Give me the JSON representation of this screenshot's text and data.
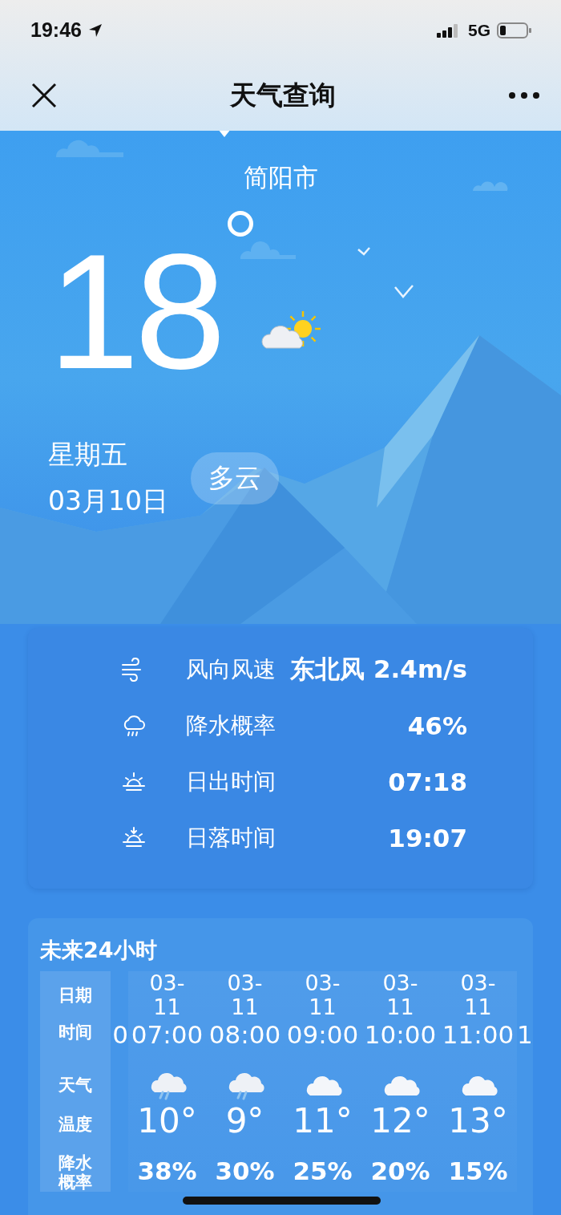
{
  "status_bar": {
    "time": "19:46",
    "network": "5G"
  },
  "nav": {
    "title": "天气查询"
  },
  "location": {
    "city": "简阳市"
  },
  "current": {
    "temperature": "18",
    "icon": {
      "kind": "partly_cloudy"
    },
    "weekday": "星期五",
    "date": "03月10日",
    "condition": "多云"
  },
  "details": [
    {
      "kind": "wind",
      "label": "风向风速",
      "value": "东北风 2.4m/s"
    },
    {
      "kind": "rain",
      "label": "降水概率",
      "value": "46%"
    },
    {
      "kind": "sunrise",
      "label": "日出时间",
      "value": "07:18"
    },
    {
      "kind": "sunset",
      "label": "日落时间",
      "value": "19:07"
    }
  ],
  "hourly": {
    "title": "未来24小时",
    "row_labels": [
      "日期",
      "时间",
      "天气",
      "温度",
      "降水概率"
    ],
    "columns": [
      {
        "kind": "partial",
        "time": "0"
      },
      {
        "kind": "full",
        "date": "03-11",
        "time": "07:00",
        "icon": {
          "kind": "rain"
        },
        "temp": "10°",
        "rain": "38%"
      },
      {
        "kind": "full",
        "date": "03-11",
        "time": "08:00",
        "icon": {
          "kind": "rain"
        },
        "temp": "9°",
        "rain": "30%"
      },
      {
        "kind": "full",
        "date": "03-11",
        "time": "09:00",
        "icon": {
          "kind": "cloudy"
        },
        "temp": "11°",
        "rain": "25%"
      },
      {
        "kind": "full",
        "date": "03-11",
        "time": "10:00",
        "icon": {
          "kind": "cloudy"
        },
        "temp": "12°",
        "rain": "20%"
      },
      {
        "kind": "full",
        "date": "03-11",
        "time": "11:00",
        "icon": {
          "kind": "cloudy"
        },
        "temp": "13°",
        "rain": "15%"
      },
      {
        "kind": "partial",
        "time": "1"
      }
    ]
  }
}
